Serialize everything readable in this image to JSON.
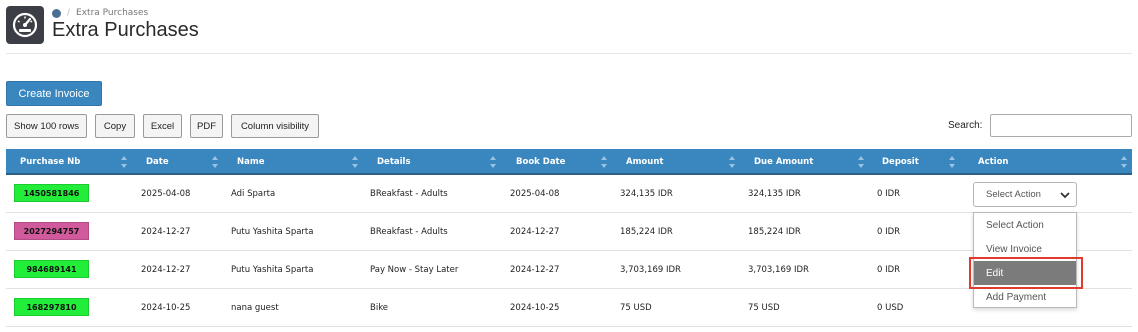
{
  "breadcrumb": {
    "current": "Extra Purchases"
  },
  "page": {
    "title": "Extra Purchases"
  },
  "toolbar": {
    "create_invoice": "Create Invoice",
    "show_rows": "Show 100 rows",
    "copy": "Copy",
    "excel": "Excel",
    "pdf": "PDF",
    "column_visibility": "Column visibility",
    "search_label": "Search:",
    "search_value": ""
  },
  "table": {
    "headers": [
      "Purchase Nb",
      "Date",
      "Name",
      "Details",
      "Book Date",
      "Amount",
      "Due Amount",
      "Deposit",
      "Action"
    ],
    "rows": [
      {
        "purchase_nb": "1450581846",
        "badge_color": "#22ee3a",
        "date": "2025-04-08",
        "name": "Adi Sparta",
        "details": "BReakfast - Adults",
        "book_date": "2025-04-08",
        "amount": "324,135 IDR",
        "due_amount": "324,135 IDR",
        "deposit": "0 IDR",
        "action": "Select Action"
      },
      {
        "purchase_nb": "2027294757",
        "badge_color": "#d05a9c",
        "date": "2024-12-27",
        "name": "Putu Yashita Sparta",
        "details": "BReakfast - Adults",
        "book_date": "2024-12-27",
        "amount": "185,224 IDR",
        "due_amount": "185,224 IDR",
        "deposit": "0 IDR",
        "action": "Select Action"
      },
      {
        "purchase_nb": "984689141",
        "badge_color": "#22ee3a",
        "date": "2024-12-27",
        "name": "Putu Yashita Sparta",
        "details": "Pay Now - Stay Later",
        "book_date": "2024-12-27",
        "amount": "3,703,169 IDR",
        "due_amount": "3,703,169 IDR",
        "deposit": "0 IDR",
        "action": "Select Action"
      },
      {
        "purchase_nb": "168297810",
        "badge_color": "#22ee3a",
        "date": "2024-10-25",
        "name": "nana guest",
        "details": "Bike",
        "book_date": "2024-10-25",
        "amount": "75 USD",
        "due_amount": "75 USD",
        "deposit": "0 USD",
        "action": "Select Action"
      }
    ]
  },
  "dropdown": {
    "options": [
      "Select Action",
      "View Invoice",
      "Edit",
      "Add Payment"
    ],
    "selected": "Edit"
  },
  "colors": {
    "header_blue": "#3a87c0",
    "highlight_red": "#e23a2f",
    "selected_option": "#7b7b7b"
  }
}
